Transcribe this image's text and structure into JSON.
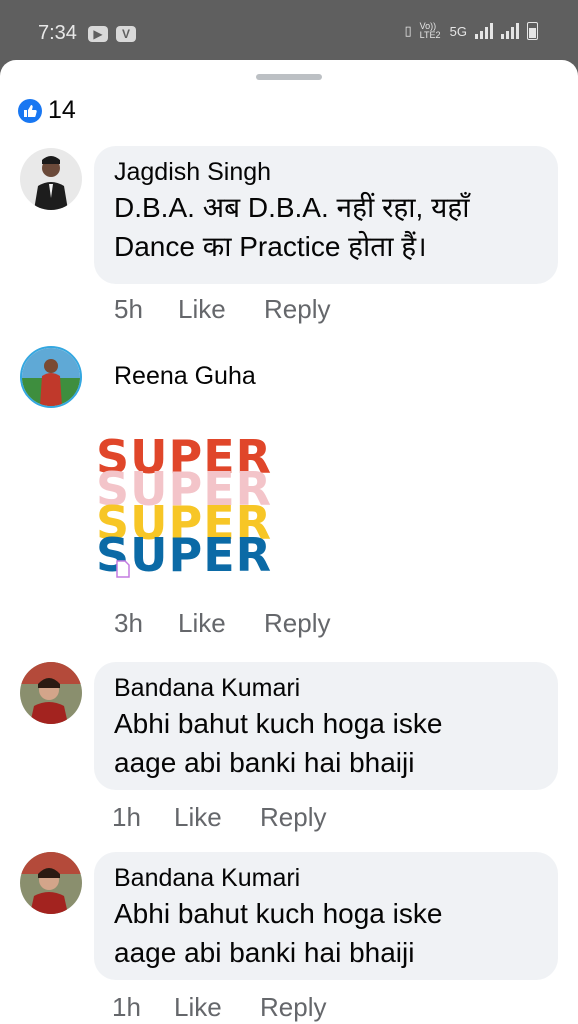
{
  "status_bar": {
    "time": "7:34",
    "network_label": "Vo)) LTE2",
    "network_type": "5G"
  },
  "reactions": {
    "count": "14",
    "icon": "thumbs-up-icon",
    "color": "#1877f2"
  },
  "comments": [
    {
      "author": "Jagdish Singh",
      "lines": [
        "D.B.A. अब D.B.A. नहीं रहा, यहाँ",
        "Dance का Practice होता हैं।"
      ],
      "time": "5h",
      "like": "Like",
      "reply": "Reply"
    },
    {
      "author": "Reena Guha",
      "sticker": {
        "word": "SUPER",
        "colors": [
          "#e0462a",
          "#f3c4c9",
          "#f7c626",
          "#0b6aa6"
        ]
      },
      "time": "3h",
      "like": "Like",
      "reply": "Reply"
    },
    {
      "author": "Bandana Kumari",
      "lines": [
        "Abhi bahut kuch hoga iske",
        "aage abi banki hai bhaiji"
      ],
      "time": "1h",
      "like": "Like",
      "reply": "Reply"
    },
    {
      "author": "Bandana Kumari",
      "lines": [
        "Abhi bahut kuch hoga iske",
        "aage abi banki hai bhaiji"
      ],
      "time": "1h",
      "like": "Like",
      "reply": "Reply"
    }
  ]
}
